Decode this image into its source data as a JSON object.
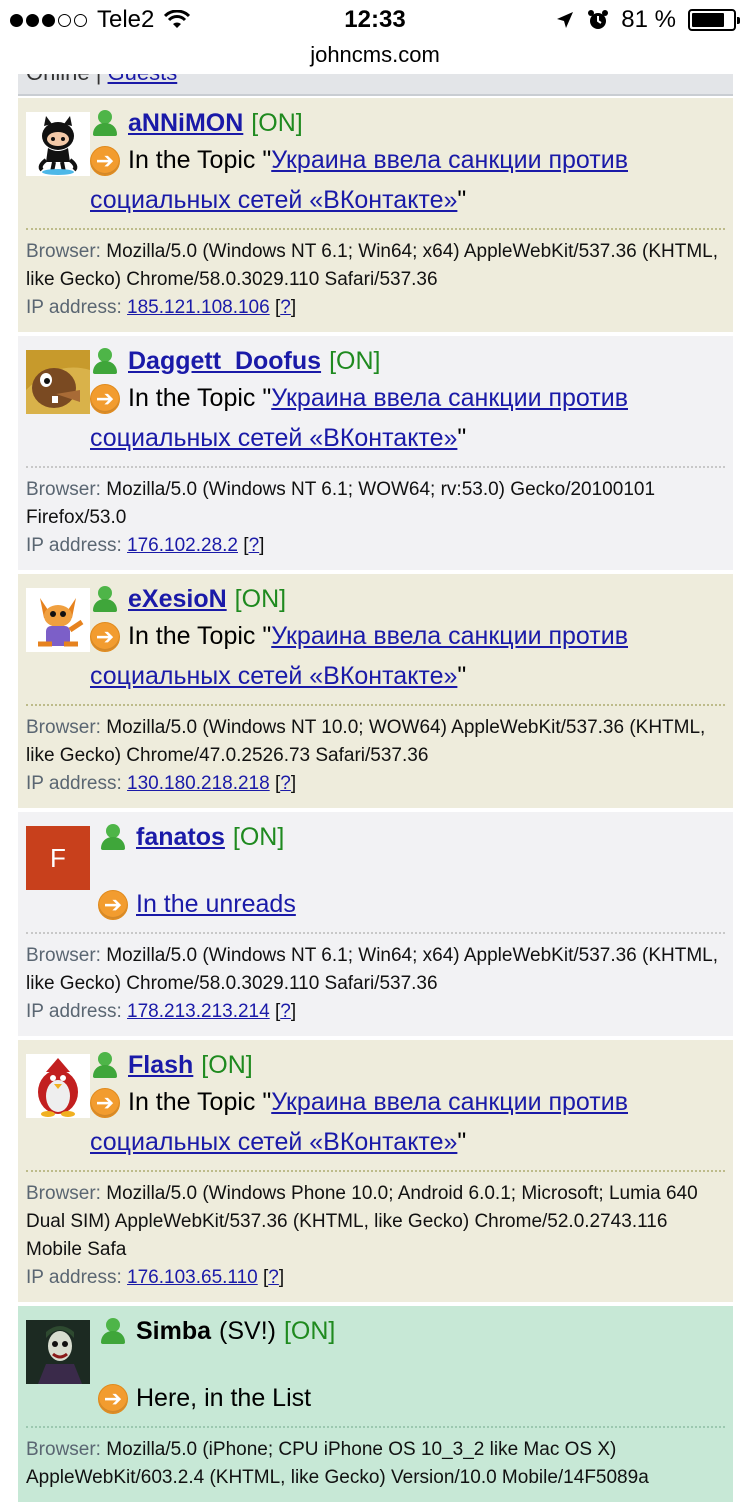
{
  "status": {
    "carrier": "Tele2",
    "time": "12:33",
    "battery": "81 %",
    "battery_level": 0.81
  },
  "url": "johncms.com",
  "top_partial": {
    "text": "Online",
    "link": "Guests"
  },
  "labels": {
    "browser": "Browser:",
    "ip": "IP address:",
    "on": "[ON]",
    "in_topic": "In the Topic",
    "help_open": "[",
    "help": "?",
    "help_close": "]"
  },
  "users": [
    {
      "name": "aNNiMON",
      "status": "[ON]",
      "location_prefix": "In the Topic \"",
      "location_link": "Украина ввела санкции против социальных сетей «ВКонтакте»",
      "location_suffix": "\"",
      "browser": "Mozilla/5.0 (Windows NT 6.1; Win64; x64) AppleWebKit/537.36 (KHTML, like Gecko) Chrome/58.0.3029.110 Safari/537.36",
      "ip": "185.121.108.106",
      "avatar": "octocat-icon"
    },
    {
      "name": "Daggett_Doofus",
      "status": "[ON]",
      "location_prefix": "In the Topic \"",
      "location_link": "Украина ввела санкции против социальных сетей «ВКонтакте»",
      "location_suffix": "\"",
      "browser": "Mozilla/5.0 (Windows NT 6.1; WOW64; rv:53.0) Gecko/20100101 Firefox/53.0",
      "ip": "176.102.28.2",
      "avatar": "beaver-icon"
    },
    {
      "name": "eXesioN",
      "status": "[ON]",
      "location_prefix": "In the Topic \"",
      "location_link": "Украина ввела санкции против социальных сетей «ВКонтакте»",
      "location_suffix": "\"",
      "browser": "Mozilla/5.0 (Windows NT 10.0; WOW64) AppleWebKit/537.36 (KHTML, like Gecko) Chrome/47.0.2526.73 Safari/537.36",
      "ip": "130.180.218.218",
      "avatar": "fox-icon"
    },
    {
      "name": "fanatos",
      "status": "[ON]",
      "location_link": "In the unreads",
      "browser": "Mozilla/5.0 (Windows NT 6.1; Win64; x64) AppleWebKit/537.36 (KHTML, like Gecko) Chrome/58.0.3029.110 Safari/537.36",
      "ip": "178.213.213.214",
      "avatar_letter": "F"
    },
    {
      "name": "Flash",
      "status": "[ON]",
      "location_prefix": "In the Topic \"",
      "location_link": "Украина ввела санкции против социальных сетей «ВКонтакте»",
      "location_suffix": "\"",
      "browser": "Mozilla/5.0 (Windows Phone 10.0; Android 6.0.1; Microsoft; Lumia 640 Dual SIM) AppleWebKit/537.36 (KHTML, like Gecko) Chrome/52.0.2743.116 Mobile Safa",
      "ip": "176.103.65.110",
      "avatar": "penguin-icon"
    },
    {
      "name": "Simba",
      "role": "(SV!)",
      "status": "[ON]",
      "location_text": "Here, in the List",
      "browser": "Mozilla/5.0 (iPhone; CPU iPhone OS 10_3_2 like Mac OS X) AppleWebKit/603.2.4 (KHTML, like Gecko) Version/10.0 Mobile/14F5089a",
      "avatar": "joker-icon"
    }
  ],
  "colors": {
    "link": "#1a1aa8",
    "online": "#1f8a1f",
    "row_a": "#eeecdc",
    "row_b": "#f2f2f4",
    "row_self": "#c7e8d6"
  }
}
